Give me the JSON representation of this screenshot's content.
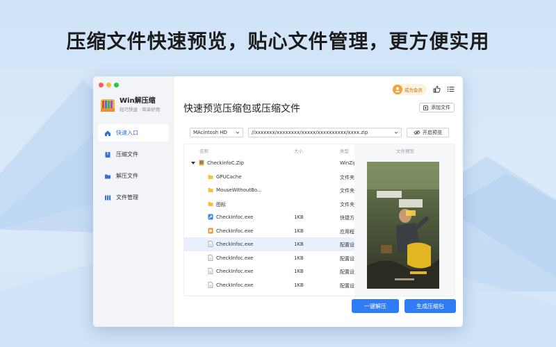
{
  "headline": "压缩文件快速预览，贴心文件管理，更方便实用",
  "colors": {
    "accent": "#2f7cf6",
    "selected_row": "#e8f0fd",
    "member_text": "#c06d10"
  },
  "app": {
    "name": "Win解压缩",
    "tagline": "轻巧快速 · 简单好用"
  },
  "sidebar": {
    "items": [
      {
        "label": "快速入口",
        "icon": "home-icon",
        "active": true
      },
      {
        "label": "压缩文件",
        "icon": "archive-icon",
        "active": false
      },
      {
        "label": "解压文件",
        "icon": "folder-icon",
        "active": false
      },
      {
        "label": "文件管理",
        "icon": "grid-icon",
        "active": false
      }
    ]
  },
  "topbar": {
    "member_label": "成为会员"
  },
  "main": {
    "title": "快速预览压缩包或压缩文件",
    "add_file_label": "添加文件",
    "drive": "MAcintosh HD",
    "path": "//xxxxxxx/xxxxxxxx/xxxxx/xxxxxxxxxx/xxxx.zip",
    "preview_toggle": "开启预览",
    "columns": {
      "name": "名称",
      "size": "大小",
      "type": "类型",
      "preview": "文件预览"
    },
    "files": [
      {
        "name": "CheckinfoC.Zip",
        "size": "",
        "type": "WinZip",
        "icon": "zip-icon",
        "indent": 0
      },
      {
        "name": "GPUCache",
        "size": "",
        "type": "文件夹",
        "icon": "folder-icon",
        "indent": 1
      },
      {
        "name": "MouseWithoutBo...",
        "size": "",
        "type": "文件夹",
        "icon": "folder-icon",
        "indent": 1
      },
      {
        "name": "图标",
        "size": "",
        "type": "文件夹",
        "icon": "folder-icon",
        "indent": 1
      },
      {
        "name": "CheckInfoc.exe",
        "size": "1KB",
        "type": "快捷方",
        "icon": "shortcut-icon",
        "indent": 1
      },
      {
        "name": "CheckInfoc.exe",
        "size": "1KB",
        "type": "应用程",
        "icon": "app-icon",
        "indent": 1
      },
      {
        "name": "CheckInfoc.exe",
        "size": "1KB",
        "type": "配置设",
        "icon": "file-icon",
        "indent": 1,
        "selected": true
      },
      {
        "name": "CheckInfoc.exe",
        "size": "1KB",
        "type": "配置设",
        "icon": "file-icon",
        "indent": 1
      },
      {
        "name": "CheckInfoc.exe",
        "size": "1KB",
        "type": "配置设",
        "icon": "file-icon",
        "indent": 1
      },
      {
        "name": "CheckInfoc.exe",
        "size": "1KB",
        "type": "配置设",
        "icon": "file-icon",
        "indent": 1
      }
    ],
    "extract_button": "一键解压",
    "compress_button": "生成压缩包"
  }
}
